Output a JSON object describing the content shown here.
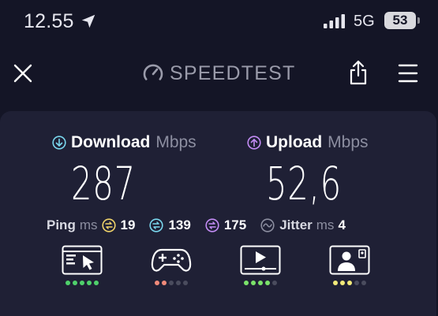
{
  "status_bar": {
    "time": "12.55",
    "network": "5G",
    "battery": "53"
  },
  "header": {
    "brand": "SPEEDTEST",
    "icons": [
      "close-icon",
      "speedometer-icon",
      "share-icon",
      "menu-icon"
    ]
  },
  "download": {
    "label": "Download",
    "unit": "Mbps",
    "value": "287",
    "icon": "arrow-down-circle-icon",
    "color": "#7ad7ee"
  },
  "upload": {
    "label": "Upload",
    "unit": "Mbps",
    "value": "52,6",
    "icon": "arrow-up-circle-icon",
    "color": "#c38cf5"
  },
  "ping": {
    "label": "Ping",
    "unit": "ms",
    "idle": "19",
    "download": "139",
    "upload": "175",
    "idle_color": "#f0d36a",
    "download_color": "#7ad7ee",
    "upload_color": "#c38cf5"
  },
  "jitter": {
    "label": "Jitter",
    "unit": "ms",
    "value": "4"
  },
  "use_cases": [
    {
      "name": "web-browsing",
      "icon": "browser-cursor-icon",
      "rating": 5,
      "color": "#4fd16b"
    },
    {
      "name": "gaming",
      "icon": "gamepad-icon",
      "rating": 2,
      "color": "#f08a7a"
    },
    {
      "name": "video-streaming",
      "icon": "video-player-icon",
      "rating": 4,
      "color": "#7be36a"
    },
    {
      "name": "video-chat",
      "icon": "video-call-icon",
      "rating": 3,
      "color": "#f2ea7a"
    }
  ]
}
